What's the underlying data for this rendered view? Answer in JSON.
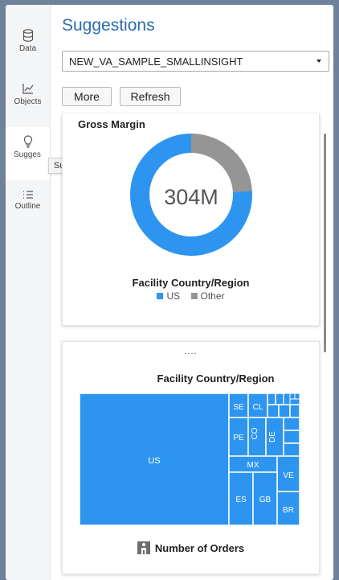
{
  "rail": {
    "items": [
      {
        "label": "Data",
        "icon": "database-icon"
      },
      {
        "label": "Objects",
        "icon": "line-chart-icon"
      },
      {
        "label": "Sugges",
        "icon": "lightbulb-icon"
      },
      {
        "label": "Outline",
        "icon": "list-icon"
      }
    ],
    "tooltip": "Suggestions"
  },
  "panel": {
    "title": "Suggestions",
    "data_source": "NEW_VA_SAMPLE_SMALLINSIGHT",
    "more_label": "More",
    "refresh_label": "Refresh"
  },
  "card1": {
    "title": "Gross Margin",
    "center_value": "304M",
    "subtitle": "Facility Country/Region",
    "legend": [
      {
        "label": "US",
        "color": "#2d95ef"
      },
      {
        "label": "Other",
        "color": "#959595"
      }
    ]
  },
  "card2": {
    "ellipsis": "....",
    "subtitle": "Facility Country/Region",
    "footer": "Number of Orders",
    "treemap_labels": [
      "US",
      "SE",
      "CL",
      "PE",
      "CO",
      "DE",
      "MX",
      "VE",
      "ES",
      "GB",
      "BR"
    ]
  },
  "chart_data": [
    {
      "type": "pie",
      "title": "Gross Margin",
      "center_label": "304M",
      "legend_title": "Facility Country/Region",
      "categories": [
        "US",
        "Other"
      ],
      "values": [
        76,
        24
      ],
      "colors": [
        "#2d95ef",
        "#959595"
      ]
    },
    {
      "type": "treemap",
      "title": "Facility Country/Region",
      "size_measure": "Number of Orders",
      "categories": [
        "US",
        "SE",
        "CL",
        "PE",
        "CO",
        "DE",
        "MX",
        "VE",
        "ES",
        "GB",
        "BR"
      ],
      "color": "#2d95ef"
    }
  ]
}
